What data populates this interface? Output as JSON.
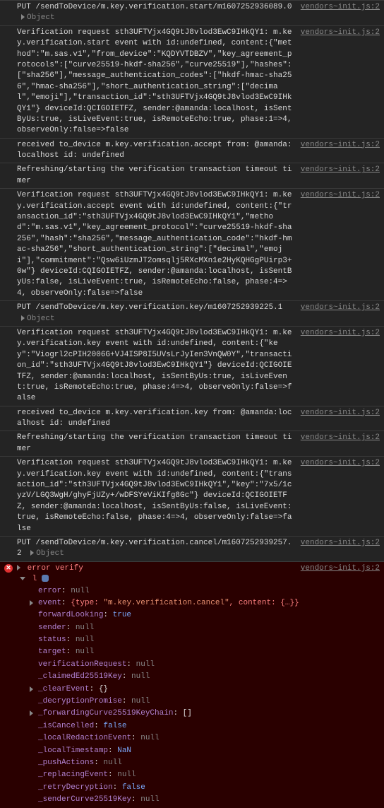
{
  "source": "vendors~init.js:2",
  "entries": [
    {
      "type": "log",
      "msg": "PUT /sendToDevice/m.key.verification.start/m1607252936089.0",
      "trail": "Object",
      "hasToggle": true
    },
    {
      "type": "log",
      "msg": "Verification request sth3UFTVjx4GQ9tJ8vlod3EwC9IHkQY1: m.key.verification.start event with id:undefined, content:{\"method\":\"m.sas.v1\",\"from_device\":\"KQDYVTDBZV\",\"key_agreement_protocols\":[\"curve25519-hkdf-sha256\",\"curve25519\"],\"hashes\":[\"sha256\"],\"message_authentication_codes\":[\"hkdf-hmac-sha256\",\"hmac-sha256\"],\"short_authentication_string\":[\"decimal\",\"emoji\"],\"transaction_id\":\"sth3UFTVjx4GQ9tJ8vlod3EwC9IHkQY1\"} deviceId:QCIGOIETFZ, sender:@amanda:localhost, isSentByUs:true, isLiveEvent:true, isRemoteEcho:true, phase:1=>4, observeOnly:false=>false"
    },
    {
      "type": "log",
      "msg": "received to_device m.key.verification.accept from: @amanda:localhost id: undefined"
    },
    {
      "type": "log",
      "msg": "Refreshing/starting the verification transaction timeout timer"
    },
    {
      "type": "log",
      "msg": "Verification request sth3UFTVjx4GQ9tJ8vlod3EwC9IHkQY1: m.key.verification.accept event with id:undefined, content:{\"transaction_id\":\"sth3UFTVjx4GQ9tJ8vlod3EwC9IHkQY1\",\"method\":\"m.sas.v1\",\"key_agreement_protocol\":\"curve25519-hkdf-sha256\",\"hash\":\"sha256\",\"message_authentication_code\":\"hkdf-hmac-sha256\",\"short_authentication_string\":[\"decimal\",\"emoji\"],\"commitment\":\"Qsw6iUzmJT2omsqlj5RXcMXn1e2HyKQHGgPUirp3+0w\"} deviceId:CQIGOIETFZ, sender:@amanda:localhost, isSentByUs:false, isLiveEvent:true, isRemoteEcho:false, phase:4=>4, observeOnly:false=>false"
    },
    {
      "type": "log",
      "msg": "PUT /sendToDevice/m.key.verification.key/m1607252939225.1",
      "trail": "Object",
      "hasToggle": true
    },
    {
      "type": "log",
      "msg": "Verification request sth3UFTVjx4GQ9tJ8vlod3EwC9IHkQY1: m.key.verification.key event with id:undefined, content:{\"key\":\"Viogrl2cPIH2006G+VJ4ISP8I5UVsLrJyIen3VnQW0Y\",\"transaction_id\":\"sth3UFTVjx4GQ9tJ8vlod3EwC9IHkQY1\"} deviceId:QCIGOIETFZ, sender:@amanda:localhost, isSentByUs:true, isLiveEvent:true, isRemoteEcho:true, phase:4=>4, observeOnly:false=>false"
    },
    {
      "type": "log",
      "msg": "received to_device m.key.verification.key from: @amanda:localhost id: undefined"
    },
    {
      "type": "log",
      "msg": "Refreshing/starting the verification transaction timeout timer"
    },
    {
      "type": "log",
      "msg": "Verification request sth3UFTVjx4GQ9tJ8vlod3EwC9IHkQY1: m.key.verification.key event with id:undefined, content:{\"transaction_id\":\"sth3UFTVjx4GQ9tJ8vlod3EwC9IHkQY1\",\"key\":\"7x5/1cyzV/LGQ3WgH/ghyFjUZy+/wDFSYeViKIfg8Gc\"} deviceId:QCIGOIETFZ, sender:@amanda:localhost, isSentByUs:false, isLiveEvent:true, isRemoteEcho:false, phase:4=>4, observeOnly:false=>false"
    },
    {
      "type": "log",
      "msg": "PUT /sendToDevice/m.key.verification.cancel/m1607252939257.2",
      "trail": "Object",
      "hasToggle": true
    }
  ],
  "error": {
    "label": "error verify",
    "expandedLabel": "l",
    "props": [
      {
        "k": "error",
        "v": "null",
        "t": "null"
      },
      {
        "k": "event",
        "raw": "{type: \"m.key.verification.cancel\", content: {…}}",
        "t": "event",
        "expandable": true
      },
      {
        "k": "forwardLooking",
        "v": "true",
        "t": "true"
      },
      {
        "k": "sender",
        "v": "null",
        "t": "null"
      },
      {
        "k": "status",
        "v": "null",
        "t": "null"
      },
      {
        "k": "target",
        "v": "null",
        "t": "null"
      },
      {
        "k": "verificationRequest",
        "v": "null",
        "t": "null"
      },
      {
        "k": "_claimedEd25519Key",
        "v": "null",
        "t": "null"
      },
      {
        "k": "_clearEvent",
        "v": "{}",
        "t": "obj",
        "expandable": true
      },
      {
        "k": "_decryptionPromise",
        "v": "null",
        "t": "null"
      },
      {
        "k": "_forwardingCurve25519KeyChain",
        "v": "[]",
        "t": "obj",
        "expandable": true
      },
      {
        "k": "_isCancelled",
        "v": "false",
        "t": "false"
      },
      {
        "k": "_localRedactionEvent",
        "v": "null",
        "t": "null"
      },
      {
        "k": "_localTimestamp",
        "v": "NaN",
        "t": "nan"
      },
      {
        "k": "_pushActions",
        "v": "null",
        "t": "null"
      },
      {
        "k": "_replacingEvent",
        "v": "null",
        "t": "null"
      },
      {
        "k": "_retryDecryption",
        "v": "false",
        "t": "false"
      },
      {
        "k": "_senderCurve25519Key",
        "v": "null",
        "t": "null"
      }
    ],
    "eventTypeStr": "\"m.key.verification.cancel\""
  }
}
